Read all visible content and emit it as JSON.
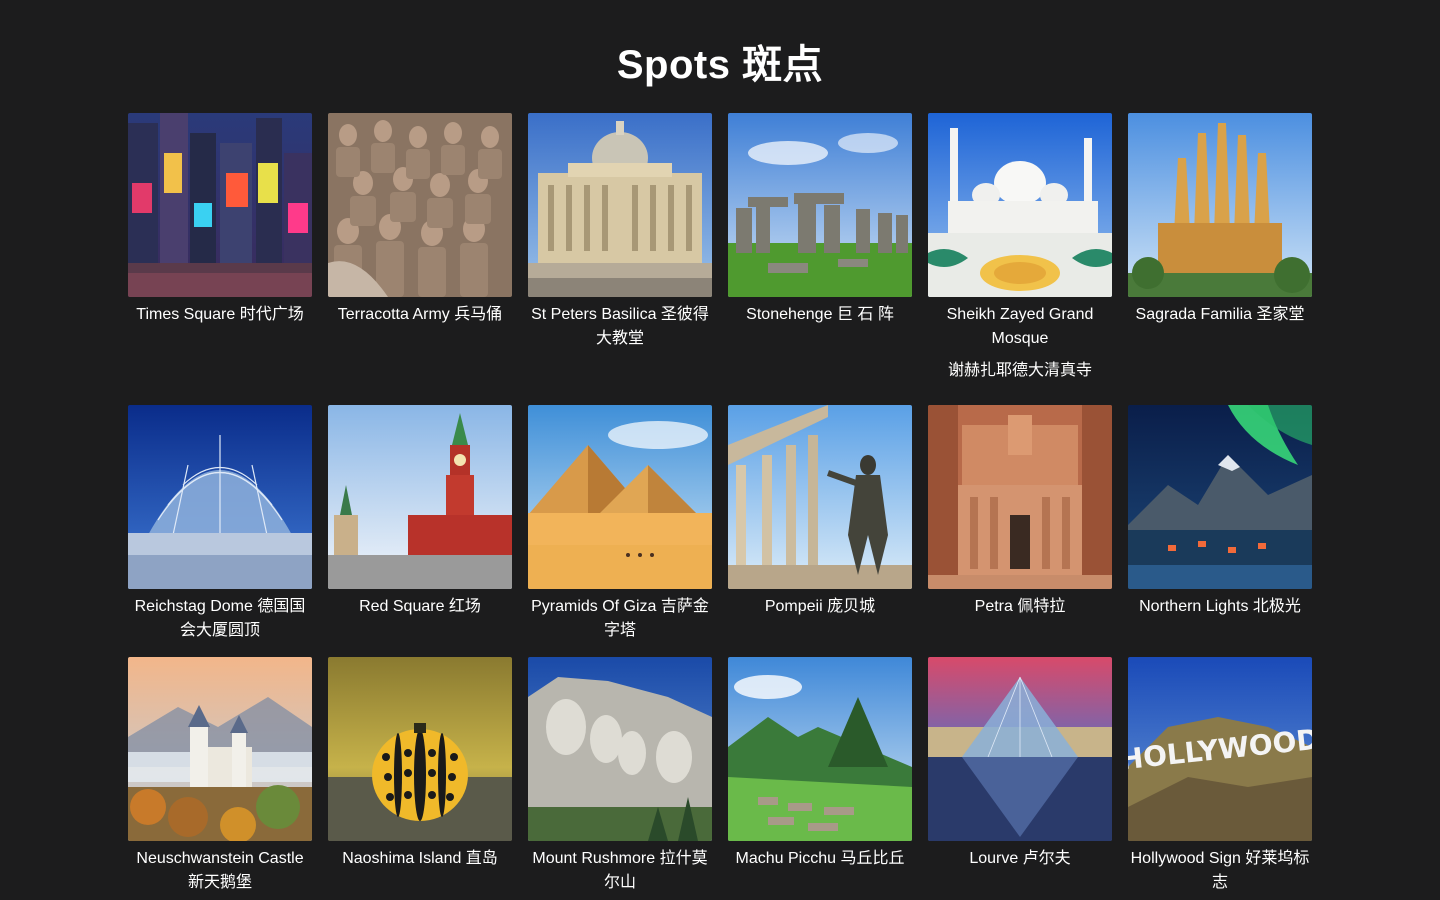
{
  "page": {
    "title": "Spots 斑点"
  },
  "spots": [
    {
      "label": "Times Square 时代广场",
      "icon": "times-square-photo"
    },
    {
      "label": "Terracotta Army 兵马俑",
      "icon": "terracotta-army-photo"
    },
    {
      "label": "St Peters Basilica 圣彼得大教堂",
      "icon": "st-peters-basilica-photo"
    },
    {
      "label": "Stonehenge 巨 石 阵",
      "icon": "stonehenge-photo"
    },
    {
      "label": "Sheikh Zayed Grand Mosque",
      "extra": "谢赫扎耶德大清真寺",
      "icon": "sheikh-zayed-mosque-photo"
    },
    {
      "label": "Sagrada Familia 圣家堂",
      "icon": "sagrada-familia-photo"
    },
    {
      "label": "Reichstag Dome 德国国会大厦圆顶",
      "icon": "reichstag-dome-photo"
    },
    {
      "label": "Red Square 红场",
      "icon": "red-square-photo"
    },
    {
      "label": "Pyramids Of Giza 吉萨金字塔",
      "icon": "pyramids-of-giza-photo"
    },
    {
      "label": "Pompeii 庞贝城",
      "icon": "pompeii-photo"
    },
    {
      "label": "Petra 佩特拉",
      "icon": "petra-photo"
    },
    {
      "label": "Northern Lights 北极光",
      "icon": "northern-lights-photo"
    },
    {
      "label": "Neuschwanstein Castle 新天鹅堡",
      "icon": "neuschwanstein-castle-photo"
    },
    {
      "label": "Naoshima Island 直岛",
      "icon": "naoshima-island-photo"
    },
    {
      "label": "Mount Rushmore 拉什莫尔山",
      "icon": "mount-rushmore-photo"
    },
    {
      "label": "Machu Picchu 马丘比丘",
      "icon": "machu-picchu-photo"
    },
    {
      "label": "Lourve 卢尔夫",
      "icon": "louvre-photo"
    },
    {
      "label": "Hollywood Sign 好莱坞标志",
      "icon": "hollywood-sign-photo",
      "sign_text": "HOLLYWOOD"
    }
  ],
  "colors": {
    "background": "#1c1c1d",
    "text": "#ffffff"
  }
}
